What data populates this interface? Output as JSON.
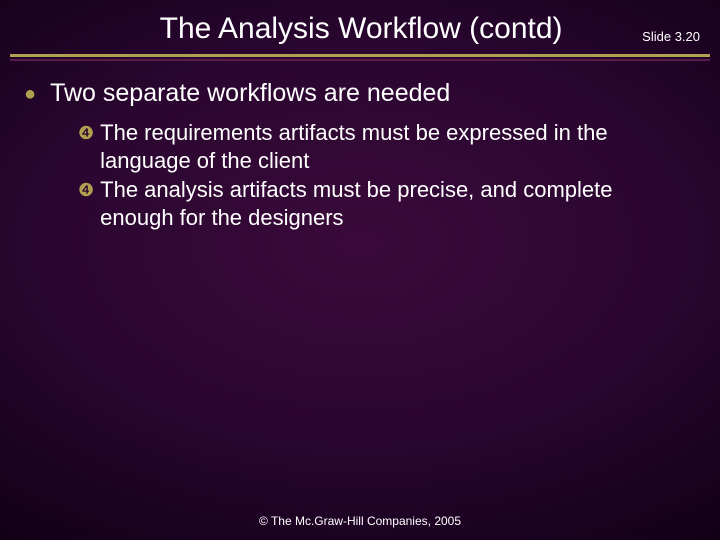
{
  "header": {
    "title": "The Analysis Workflow (contd)",
    "slide_number": "Slide 3.20"
  },
  "body": {
    "main_point": "Two separate workflows are needed",
    "sub_points": [
      "The requirements artifacts must be expressed in the language of the client",
      "The analysis artifacts must be precise, and complete enough for the designers"
    ]
  },
  "footer": {
    "copyright": "© The Mc.Graw-Hill Companies, 2005"
  }
}
